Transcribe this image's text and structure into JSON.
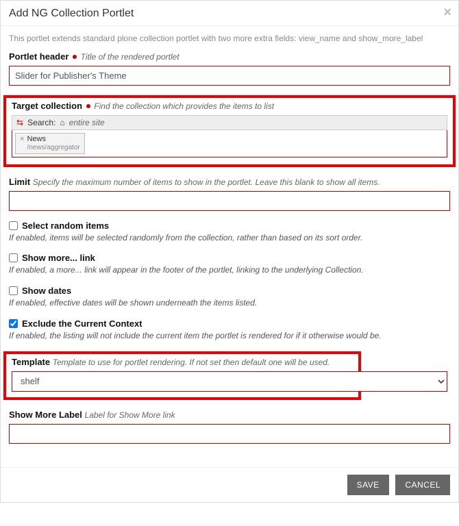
{
  "dialog": {
    "title": "Add NG Collection Portlet",
    "intro": "This portlet extends standard plone collection portlet with two more extra fields: view_name and show_more_label"
  },
  "portlet_header": {
    "label": "Portlet header",
    "help": "Title of the rendered portlet",
    "value": "Slider for Publisher's Theme"
  },
  "target": {
    "label": "Target collection",
    "help": "Find the collection which provides the items to list",
    "search_label": "Search:",
    "site_text": "entire site",
    "token_name": "News",
    "token_path": "/news/aggregator"
  },
  "limit": {
    "label": "Limit",
    "help": "Specify the maximum number of items to show in the portlet. Leave this blank to show all items.",
    "value": ""
  },
  "random": {
    "label": "Select random items",
    "desc": "If enabled, items will be selected randomly from the collection, rather than based on its sort order."
  },
  "showmore": {
    "label": "Show more... link",
    "desc": "If enabled, a more... link will appear in the footer of the portlet, linking to the underlying Collection."
  },
  "dates": {
    "label": "Show dates",
    "desc": "If enabled, effective dates will be shown underneath the items listed."
  },
  "exclude": {
    "label": "Exclude the Current Context",
    "desc": "If enabled, the listing will not include the current item the portlet is rendered for if it otherwise would be."
  },
  "template": {
    "label": "Template",
    "help": "Template to use for portlet rendering. If not set then default one will be used.",
    "value": "shelf"
  },
  "showmore_label": {
    "label": "Show More Label",
    "help": "Label for Show More link",
    "value": ""
  },
  "buttons": {
    "save": "SAVE",
    "cancel": "CANCEL"
  }
}
